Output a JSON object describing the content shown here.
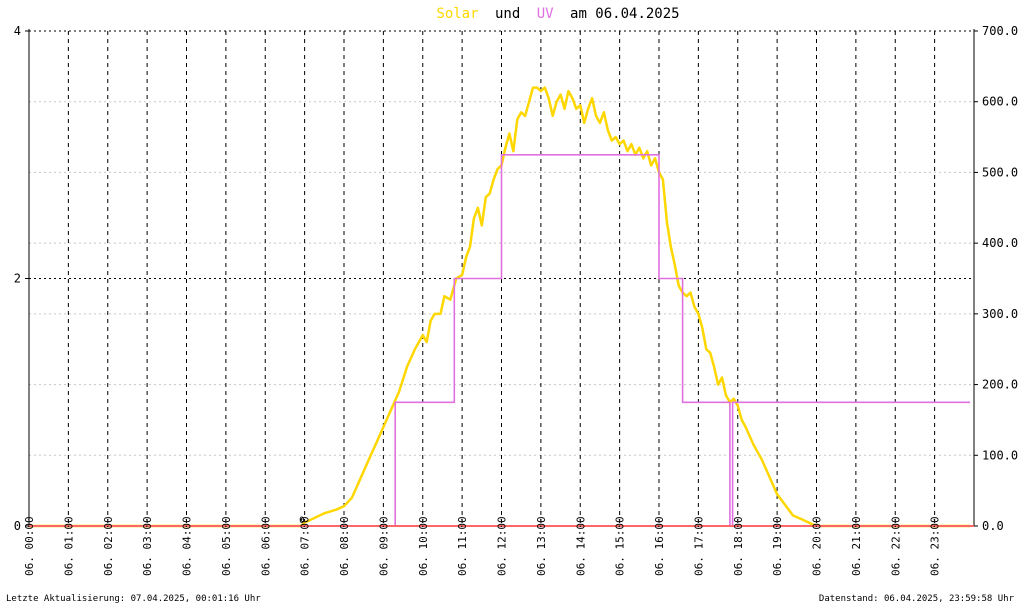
{
  "title_parts": {
    "solar_word": "Solar",
    "und_word": "und",
    "uv_word": "UV",
    "rest": "am 06.04.2025"
  },
  "footer": {
    "left": "Letzte Aktualisierung: 07.04.2025, 00:01:16 Uhr",
    "right": "Datenstand: 06.04.2025, 23:59:58 Uhr"
  },
  "colors": {
    "solar": "#ffd700",
    "uv": "#e070e0",
    "baseline": "#ff6666",
    "title_solar": "#ffd700",
    "title_uv": "#e070e0",
    "title_text": "#000000"
  },
  "chart_data": {
    "type": "line",
    "x_unit": "hours",
    "xlim": [
      0,
      24
    ],
    "x_ticks": [
      0,
      1,
      2,
      3,
      4,
      5,
      6,
      7,
      8,
      9,
      10,
      11,
      12,
      13,
      14,
      15,
      16,
      17,
      18,
      19,
      20,
      21,
      22,
      23
    ],
    "x_tick_labels": [
      "06. 00:00",
      "06. 01:00",
      "06. 02:00",
      "06. 03:00",
      "06. 04:00",
      "06. 05:00",
      "06. 06:00",
      "06. 07:00",
      "06. 08:00",
      "06. 09:00",
      "06. 10:00",
      "06. 11:00",
      "06. 12:00",
      "06. 13:00",
      "06. 14:00",
      "06. 15:00",
      "06. 16:00",
      "06. 17:00",
      "06. 18:00",
      "06. 19:00",
      "06. 20:00",
      "06. 21:00",
      "06. 22:00",
      "06. 23:00"
    ],
    "y_left": {
      "lim": [
        0,
        4
      ],
      "ticks": [
        0,
        2,
        4
      ],
      "tick_labels": [
        "0",
        "2",
        "4"
      ]
    },
    "y_right": {
      "lim": [
        0,
        700
      ],
      "ticks": [
        0,
        100,
        200,
        300,
        400,
        500,
        600,
        700
      ],
      "tick_labels": [
        "0.0",
        "100.0",
        "200.0",
        "300.0",
        "400.0",
        "500.0",
        "600.0",
        "700.0"
      ]
    },
    "grid": true,
    "zero_marker_label": "0",
    "zero_marker_x": 6.93,
    "series": [
      {
        "key": "solar",
        "axis": "right",
        "x": [
          0,
          6.9,
          7.0,
          7.2,
          7.5,
          7.8,
          8.0,
          8.2,
          8.4,
          8.6,
          8.8,
          9.0,
          9.2,
          9.4,
          9.6,
          9.8,
          10.0,
          10.1,
          10.2,
          10.3,
          10.45,
          10.55,
          10.7,
          10.85,
          11.0,
          11.1,
          11.2,
          11.3,
          11.4,
          11.5,
          11.6,
          11.7,
          11.8,
          11.9,
          12.0,
          12.1,
          12.2,
          12.3,
          12.4,
          12.5,
          12.6,
          12.7,
          12.8,
          12.9,
          13.0,
          13.1,
          13.2,
          13.3,
          13.4,
          13.5,
          13.6,
          13.7,
          13.8,
          13.9,
          14.0,
          14.1,
          14.2,
          14.3,
          14.4,
          14.5,
          14.6,
          14.7,
          14.8,
          14.9,
          15.0,
          15.1,
          15.2,
          15.3,
          15.4,
          15.5,
          15.6,
          15.7,
          15.8,
          15.9,
          16.0,
          16.1,
          16.2,
          16.3,
          16.4,
          16.5,
          16.6,
          16.7,
          16.8,
          16.9,
          17.0,
          17.1,
          17.2,
          17.3,
          17.4,
          17.5,
          17.6,
          17.7,
          17.8,
          17.9,
          18.0,
          18.1,
          18.2,
          18.4,
          18.6,
          18.8,
          19.0,
          19.2,
          19.4,
          19.6,
          19.8,
          19.95,
          20.1,
          23.9
        ],
        "values": [
          0,
          0,
          5,
          10,
          18,
          23,
          28,
          40,
          65,
          90,
          115,
          140,
          165,
          190,
          225,
          250,
          270,
          260,
          290,
          300,
          300,
          325,
          320,
          350,
          355,
          380,
          395,
          435,
          450,
          425,
          465,
          470,
          490,
          505,
          510,
          535,
          555,
          530,
          575,
          585,
          580,
          600,
          620,
          620,
          615,
          620,
          605,
          580,
          600,
          610,
          590,
          615,
          605,
          590,
          595,
          570,
          590,
          605,
          580,
          570,
          585,
          560,
          545,
          550,
          540,
          545,
          530,
          540,
          525,
          535,
          520,
          530,
          510,
          520,
          500,
          490,
          430,
          395,
          370,
          340,
          330,
          325,
          330,
          310,
          300,
          280,
          250,
          245,
          225,
          200,
          210,
          185,
          175,
          180,
          170,
          150,
          140,
          115,
          95,
          70,
          45,
          30,
          15,
          10,
          5,
          1,
          0,
          0
        ]
      },
      {
        "key": "uv",
        "axis": "left",
        "x": [
          0,
          9.3,
          9.3,
          10.8,
          10.8,
          12.0,
          12.0,
          16.0,
          16.0,
          16.6,
          16.6,
          17.8,
          17.8,
          17.87,
          17.87,
          23.9
        ],
        "values": [
          0,
          0,
          1,
          1,
          2,
          2,
          3,
          3,
          2,
          2,
          1,
          1,
          0,
          0,
          1,
          1
        ]
      }
    ]
  }
}
